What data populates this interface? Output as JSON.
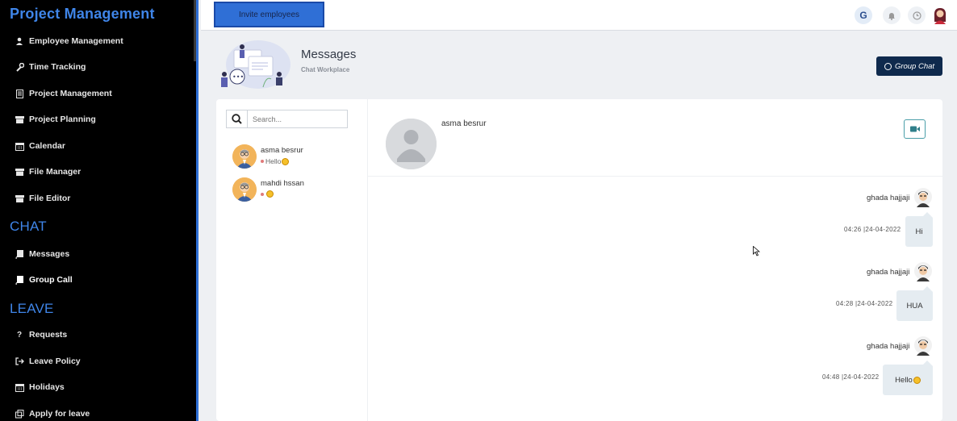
{
  "sidebar": {
    "project_section": "Project Management",
    "chat_section": "CHAT",
    "leave_section": "LEAVE",
    "items": [
      {
        "label": "Employee Management",
        "icon": "user-icon"
      },
      {
        "label": "Time Tracking",
        "icon": "wrench-icon"
      },
      {
        "label": "Project Management",
        "icon": "document-icon"
      },
      {
        "label": "Project Planning",
        "icon": "folder-icon"
      },
      {
        "label": "Calendar",
        "icon": "calendar-icon"
      },
      {
        "label": "File Manager",
        "icon": "folder-icon"
      },
      {
        "label": "File Editor",
        "icon": "folder-icon"
      },
      {
        "label": "Messages",
        "icon": "book-icon"
      },
      {
        "label": "Group Call",
        "icon": "book-icon"
      },
      {
        "label": "Requests",
        "icon": "question-icon"
      },
      {
        "label": "Leave Policy",
        "icon": "sign-out-icon"
      },
      {
        "label": "Holidays",
        "icon": "calendar-icon"
      },
      {
        "label": "Apply for leave",
        "icon": "clone-icon"
      }
    ]
  },
  "topbar": {
    "invite_label": "Invite employees",
    "g_label": "G"
  },
  "header": {
    "title": "Messages",
    "subtitle": "Chat Workplace",
    "group_chat_label": "Group Chat"
  },
  "search": {
    "placeholder": "Search..."
  },
  "contacts": [
    {
      "name": "asma besrur",
      "last_message": "Hello"
    },
    {
      "name": "mahdi hssan",
      "last_message": ""
    }
  ],
  "conversation": {
    "name": "asma besrur",
    "messages": [
      {
        "sender": "ghada hajjaji",
        "time": "04:26 |24-04-2022",
        "text": "Hi"
      },
      {
        "sender": "ghada hajjaji",
        "time": "04:28 |24-04-2022",
        "text": "HUA"
      },
      {
        "sender": "ghada hajjaji",
        "time": "04:48 |24-04-2022",
        "text": "Hello"
      }
    ]
  },
  "colors": {
    "accent": "#3f85e8",
    "navy": "#0f2a4d",
    "teal": "#4a9ea8"
  }
}
